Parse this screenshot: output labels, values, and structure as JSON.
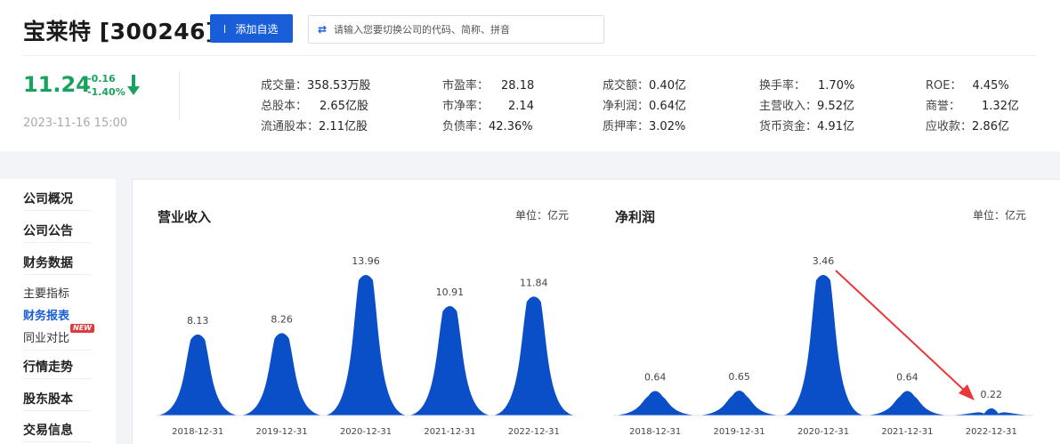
{
  "header": {
    "title": "宝莱特 [300246]",
    "add_button": "添加自选",
    "search_placeholder": "请输入您要切换公司的代码、简称、拼音"
  },
  "quote": {
    "price": "11.24",
    "change": "-0.16",
    "change_pct": "-1.40%",
    "datetime": "2023-11-16 15:00",
    "down_color": "#19a15f"
  },
  "metrics": {
    "col1": [
      {
        "label": "成交量：",
        "value": "358.53万股"
      },
      {
        "label": "总股本：",
        "value": "2.65亿股"
      },
      {
        "label": "流通股本：",
        "value": "2.11亿股"
      }
    ],
    "col2": [
      {
        "label": "市盈率：",
        "value": "28.18"
      },
      {
        "label": "市净率：",
        "value": "2.14"
      },
      {
        "label": "负债率：",
        "value": "42.36%"
      }
    ],
    "col3": [
      {
        "label": "成交额：",
        "value": "0.40亿"
      },
      {
        "label": "净利润：",
        "value": "0.64亿"
      },
      {
        "label": "质押率：",
        "value": "3.02%"
      }
    ],
    "col4": [
      {
        "label": "换手率：",
        "value": "1.70%"
      },
      {
        "label": "主营收入：",
        "value": "9.52亿"
      },
      {
        "label": "货币资金：",
        "value": "4.91亿"
      }
    ],
    "col5": [
      {
        "label": "ROE：",
        "value": "4.45%"
      },
      {
        "label": "商誉：",
        "value": "1.32亿"
      },
      {
        "label": "应收款：",
        "value": "2.86亿"
      }
    ]
  },
  "sidebar": {
    "items": [
      "公司概况",
      "公司公告",
      "财务数据"
    ],
    "sub_items": [
      "主要指标",
      "财务报表",
      "同业对比"
    ],
    "new_badge": "NEW",
    "items_bottom": [
      "行情走势",
      "股东股本",
      "交易信息"
    ]
  },
  "chart_data": [
    {
      "type": "area",
      "title": "营业收入",
      "unit": "单位：亿元",
      "categories": [
        "2018-12-31",
        "2019-12-31",
        "2020-12-31",
        "2021-12-31",
        "2022-12-31"
      ],
      "values": [
        8.13,
        8.26,
        13.96,
        10.91,
        11.84
      ],
      "labels": [
        "8.13",
        "8.26",
        "13.96",
        "10.91",
        "11.84"
      ],
      "color": "#0a4fc8"
    },
    {
      "type": "area",
      "title": "净利润",
      "unit": "单位：亿元",
      "categories": [
        "2018-12-31",
        "2019-12-31",
        "2020-12-31",
        "2021-12-31",
        "2022-12-31"
      ],
      "values": [
        0.64,
        0.65,
        3.46,
        0.64,
        0.22
      ],
      "labels": [
        "0.64",
        "0.65",
        "3.46",
        "0.64",
        "0.22"
      ],
      "color": "#0a4fc8",
      "annotation_color": "#e8383a"
    }
  ]
}
